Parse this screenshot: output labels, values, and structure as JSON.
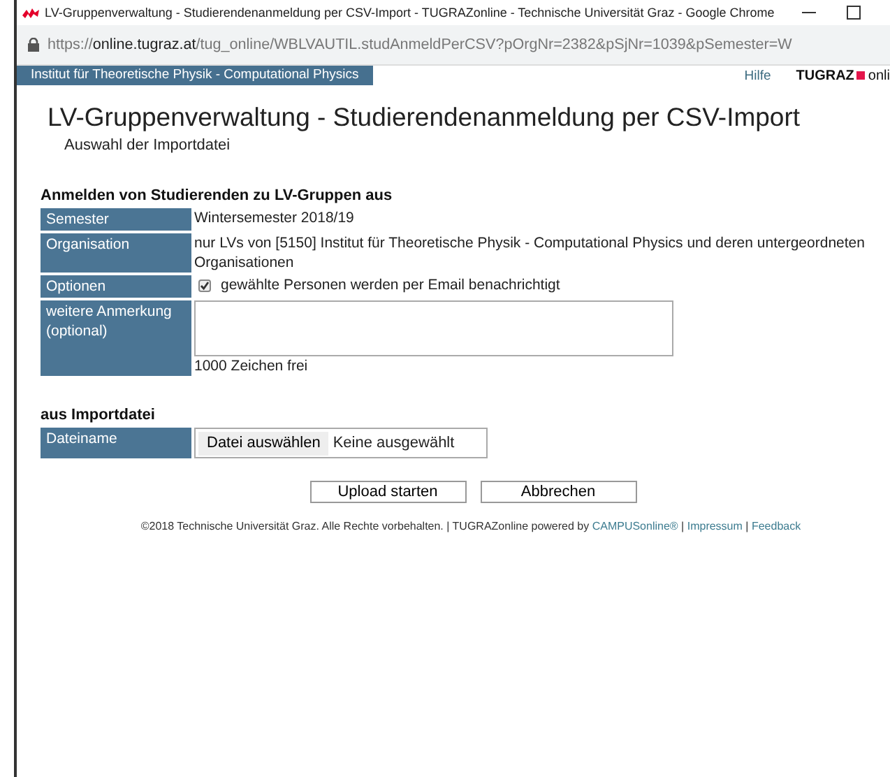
{
  "window": {
    "title": "LV-Gruppenverwaltung - Studierendenanmeldung per CSV-Import - TUGRAZonline - Technische Universität Graz - Google Chrome"
  },
  "address_bar": {
    "scheme": "https://",
    "domain": "online.tugraz.at",
    "path": "/tug_online/WBLVAUTIL.studAnmeldPerCSV?pOrgNr=2382&pSjNr=1039&pSemester=W"
  },
  "header": {
    "institute": "Institut für Theoretische Physik - Computational Physics",
    "help": "Hilfe",
    "logo_left": "TUGRAZ",
    "logo_right": "onli"
  },
  "page": {
    "title": "LV-Gruppenverwaltung - Studierendenanmeldung per CSV-Import",
    "subtitle": "Auswahl der Importdatei"
  },
  "sections": [
    {
      "heading": "Anmelden von Studierenden zu LV-Gruppen aus",
      "rows": [
        {
          "kind": "text",
          "label": "Semester",
          "value": "Wintersemester 2018/19"
        },
        {
          "kind": "text",
          "label": "Organisation",
          "value": "nur LVs von [5150] Institut für Theoretische Physik - Computational Physics und deren untergeordneten Organisationen"
        },
        {
          "kind": "checkbox",
          "label": "Optionen",
          "value": "gewählte Personen werden per Email benachrichtigt",
          "checked": true
        },
        {
          "kind": "textarea",
          "label": "weitere Anmerkung (optional)",
          "note": "1000 Zeichen frei"
        }
      ]
    },
    {
      "heading": "aus Importdatei",
      "rows": [
        {
          "kind": "file",
          "label": "Dateiname",
          "button": "Datei auswählen",
          "value": "Keine ausgewählt"
        }
      ]
    }
  ],
  "buttons": [
    "Upload starten",
    "Abbrechen"
  ],
  "footer": {
    "text": "©2018 Technische Universität Graz. Alle Rechte vorbehalten. | TUGRAZonline powered by ",
    "links": [
      "CAMPUSonline®",
      "Impressum",
      "Feedback"
    ],
    "separator": "|"
  }
}
